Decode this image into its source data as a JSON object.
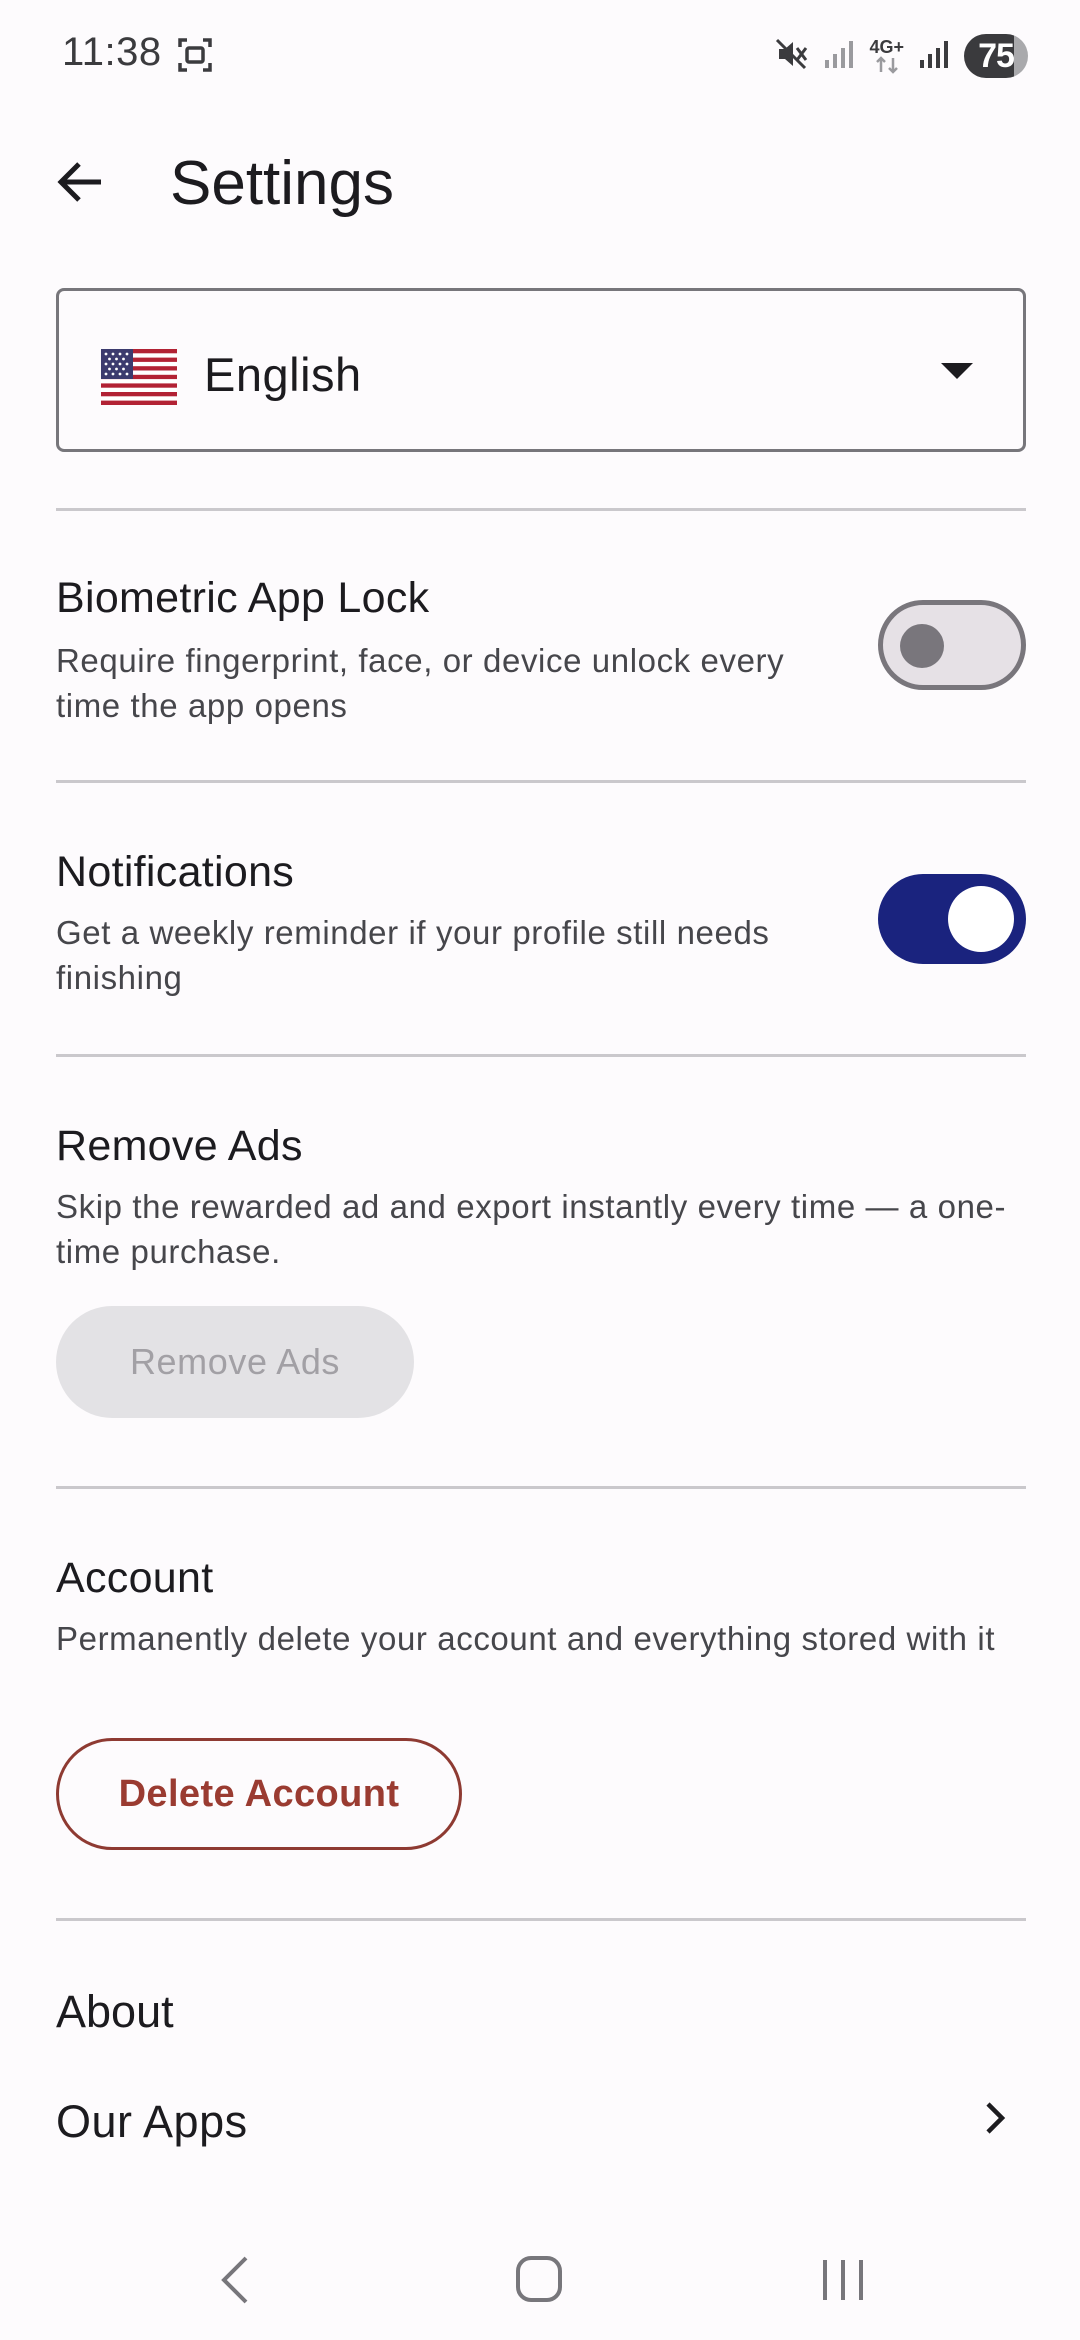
{
  "status_bar": {
    "time": "11:38",
    "network_label": "4G+",
    "battery_level": "75"
  },
  "app_bar": {
    "title": "Settings"
  },
  "language": {
    "selected": "English"
  },
  "biometric": {
    "title": "Biometric App Lock",
    "description": "Require fingerprint, face, or device unlock every time the app opens",
    "enabled": false
  },
  "notifications": {
    "title": "Notifications",
    "description": "Get a weekly reminder if your profile still needs finishing",
    "enabled": true
  },
  "remove_ads": {
    "title": "Remove Ads",
    "description": "Skip the rewarded ad and export instantly every time — a one-time purchase.",
    "button_label": "Remove Ads"
  },
  "account": {
    "title": "Account",
    "description": "Permanently delete your account and everything stored with it",
    "button_label": "Delete Account"
  },
  "about": {
    "title": "About",
    "items": [
      {
        "label": "Our Apps"
      }
    ]
  },
  "colors": {
    "accent": "#1a237e",
    "danger": "#9a3b31",
    "background": "#fdfbfd"
  }
}
